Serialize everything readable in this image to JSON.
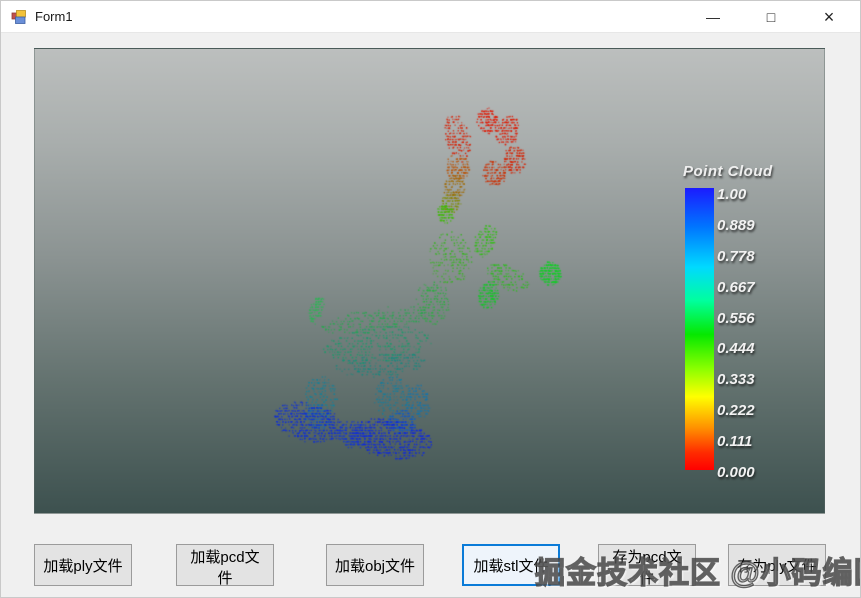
{
  "window": {
    "title": "Form1"
  },
  "icons": {
    "minimize": "—",
    "maximize": "□",
    "close": "×"
  },
  "accent_color": "#0a7bd8",
  "viewport": {
    "gradient": [
      "#bcbfbe 0%",
      "#a9aead 20%",
      "#8b9392 45%",
      "#63726f 72%",
      "#3d514f 100%"
    ],
    "point_cloud": {
      "model": "reindeer point cloud colored by height (red antlers to blue hooves)",
      "blobs": [
        [
          422,
          88,
          12,
          24,
          -15,
          170,
          "#d81f00"
        ],
        [
          452,
          71,
          10,
          12,
          0,
          140,
          "#e01800"
        ],
        [
          472,
          81,
          12,
          14,
          20,
          150,
          "#dd1a00"
        ],
        [
          479,
          111,
          11,
          14,
          0,
          150,
          "#d62300"
        ],
        [
          459,
          123,
          12,
          12,
          0,
          140,
          "#cc3000"
        ],
        [
          422,
          118,
          12,
          12,
          0,
          130,
          "#bb5200"
        ],
        [
          419,
          138,
          10,
          13,
          5,
          110,
          "#a06a00"
        ],
        [
          415,
          153,
          10,
          10,
          0,
          90,
          "#7f8c00"
        ],
        [
          410,
          164,
          8,
          9,
          0,
          110,
          "#3fba06"
        ],
        [
          450,
          191,
          10,
          16,
          25,
          120,
          "#2fc011"
        ],
        [
          415,
          208,
          22,
          26,
          0,
          180,
          "#35b51e"
        ],
        [
          472,
          228,
          22,
          12,
          22,
          130,
          "#2dbb1e"
        ],
        [
          515,
          224,
          11,
          11,
          0,
          220,
          "#12cd26"
        ],
        [
          453,
          245,
          10,
          13,
          10,
          170,
          "#17c52a"
        ],
        [
          397,
          253,
          17,
          22,
          0,
          160,
          "#2aaf3f"
        ],
        [
          281,
          261,
          7,
          14,
          15,
          90,
          "#2cb554"
        ],
        [
          339,
          271,
          55,
          11,
          -8,
          220,
          "#27a84e"
        ],
        [
          342,
          295,
          55,
          18,
          -6,
          320,
          "#1d9a6b"
        ],
        [
          345,
          315,
          45,
          11,
          -4,
          190,
          "#17897f"
        ],
        [
          285,
          348,
          16,
          22,
          0,
          140,
          "#13829b"
        ],
        [
          282,
          368,
          14,
          13,
          0,
          120,
          "#1463bb"
        ],
        [
          357,
          348,
          18,
          22,
          0,
          150,
          "#127e9f"
        ],
        [
          382,
          353,
          12,
          18,
          0,
          120,
          "#1375ad"
        ],
        [
          365,
          373,
          16,
          12,
          0,
          140,
          "#1157c8"
        ],
        [
          273,
          373,
          35,
          19,
          14,
          430,
          "#0e2eda"
        ],
        [
          320,
          385,
          18,
          13,
          10,
          180,
          "#1134da"
        ],
        [
          355,
          389,
          42,
          19,
          10,
          490,
          "#0d27e2"
        ]
      ]
    }
  },
  "colorbar": {
    "title": "Point Cloud",
    "ticks": [
      "1.00",
      "0.889",
      "0.778",
      "0.667",
      "0.556",
      "0.444",
      "0.333",
      "0.222",
      "0.111",
      "0.000"
    ],
    "gradient": [
      "#1b1bff 0%",
      "#0077ff 14%",
      "#00d9ff 28%",
      "#00ff9d 40%",
      "#06e800 52%",
      "#8aff00 64%",
      "#ffff00 74%",
      "#ff9100 85%",
      "#ff2a00 94%",
      "#ff0000 100%"
    ]
  },
  "buttons": [
    {
      "label": "加载ply文件",
      "focused": false
    },
    {
      "label": "加载pcd文件",
      "focused": false
    },
    {
      "label": "加载obj文件",
      "focused": false
    },
    {
      "label": "加载stl文件",
      "focused": true
    },
    {
      "label": "存为pcd文件",
      "focused": false
    },
    {
      "label": "存为ply文件",
      "focused": false
    }
  ],
  "watermark": "掘金技术社区 @小码编匠"
}
